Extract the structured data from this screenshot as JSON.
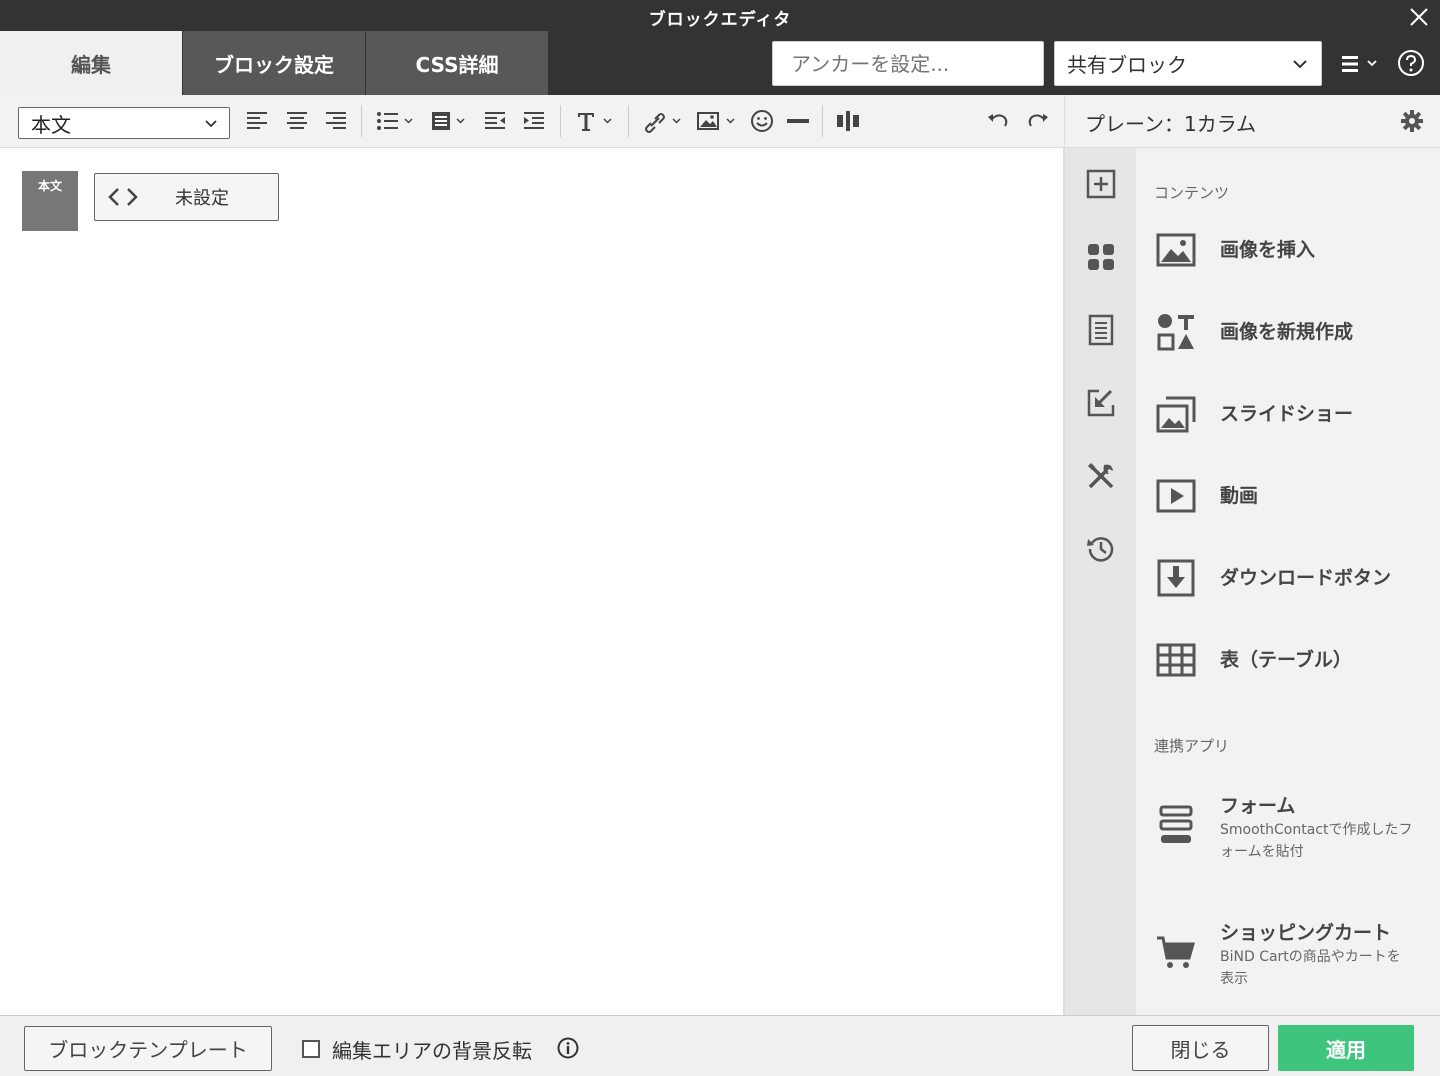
{
  "window": {
    "title": "ブロックエディタ",
    "close_icon": "close-icon"
  },
  "tabs": [
    {
      "label": "編集",
      "active": true
    },
    {
      "label": "ブロック設定",
      "active": false
    },
    {
      "label": "CSS詳細",
      "active": false
    }
  ],
  "header": {
    "anchor_placeholder": "アンカーを設定...",
    "shared_block_value": "共有ブロック"
  },
  "toolbar": {
    "style_value": "本文",
    "icons": [
      "align-left-icon",
      "align-center-icon",
      "align-right-icon",
      "list-icon",
      "block-format-icon",
      "outdent-icon",
      "indent-icon",
      "text-style-icon",
      "link-icon",
      "image-icon",
      "emoji-icon",
      "horizontal-rule-icon",
      "column-icon",
      "undo-icon",
      "redo-icon"
    ]
  },
  "edit_area": {
    "badge_label": "本文",
    "anchor_chip_label": "未設定"
  },
  "right_panel": {
    "layout_label": "プレーン：1カラム",
    "sections": {
      "contents_label": "コンテンツ",
      "apps_label": "連携アプリ"
    },
    "contents_items": [
      {
        "label": "画像を挿入",
        "icon": "image-icon"
      },
      {
        "label": "画像を新規作成",
        "icon": "shapes-icon"
      },
      {
        "label": "スライドショー",
        "icon": "slideshow-icon"
      },
      {
        "label": "動画",
        "icon": "video-icon"
      },
      {
        "label": "ダウンロードボタン",
        "icon": "download-icon"
      },
      {
        "label": "表（テーブル）",
        "icon": "table-icon"
      }
    ],
    "app_items": [
      {
        "label": "フォーム",
        "desc_line1": "SmoothContactで作成したフ",
        "desc_line2": "ォームを貼付",
        "icon": "form-icon"
      },
      {
        "label": "ショッピングカート",
        "desc_line1": "BiND Cartの商品やカートを",
        "desc_line2": "表示",
        "icon": "cart-icon"
      }
    ]
  },
  "footer": {
    "template_button": "ブロックテンプレート",
    "invert_bg_label": "編集エリアの背景反転",
    "close_button": "閉じる",
    "apply_button": "適用"
  },
  "colors": {
    "dark": "#333333",
    "apply_green": "#3ec47c",
    "tab_inactive": "#585858"
  }
}
